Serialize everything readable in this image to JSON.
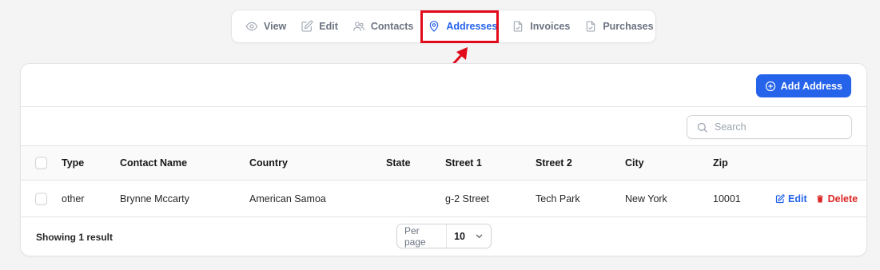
{
  "tabs": [
    {
      "label": "View",
      "icon": "eye-icon"
    },
    {
      "label": "Edit",
      "icon": "pencil-square-icon"
    },
    {
      "label": "Contacts",
      "icon": "users-icon"
    },
    {
      "label": "Addresses",
      "icon": "map-pin-icon",
      "active": true
    },
    {
      "label": "Invoices",
      "icon": "document-check-icon"
    },
    {
      "label": "Purchases",
      "icon": "document-check-icon"
    }
  ],
  "header": {
    "add_label": "Add Address"
  },
  "search": {
    "placeholder": "Search",
    "value": ""
  },
  "table": {
    "columns": [
      "Type",
      "Contact Name",
      "Country",
      "State",
      "Street 1",
      "Street 2",
      "City",
      "Zip"
    ],
    "rows": [
      {
        "type": "other",
        "contact_name": "Brynne Mccarty",
        "country": "American Samoa",
        "state": "",
        "street1": "g-2 Street",
        "street2": "Tech Park",
        "city": "New York",
        "zip": "10001"
      }
    ],
    "edit_label": "Edit",
    "delete_label": "Delete"
  },
  "footer": {
    "showing": "Showing 1 result",
    "per_page_label": "Per page",
    "per_page_value": "10"
  },
  "colors": {
    "accent": "#2563eb",
    "danger": "#dc2626",
    "highlight": "#e10b1c"
  }
}
